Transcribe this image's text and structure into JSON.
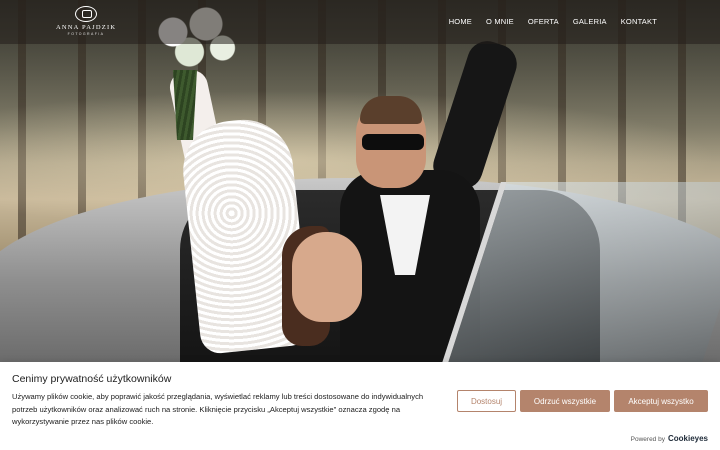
{
  "header": {
    "logo": {
      "name": "ANNA PAJDZIK",
      "subtitle": "FOTOGRAFIA"
    },
    "nav": [
      {
        "label": "HOME"
      },
      {
        "label": "O MNIE"
      },
      {
        "label": "OFERTA"
      },
      {
        "label": "GALERIA"
      },
      {
        "label": "KONTAKT"
      }
    ]
  },
  "hero": {
    "image": "wedding-photo-bride-groom-convertible-car"
  },
  "cookie_banner": {
    "title": "Cenimy prywatność użytkowników",
    "text": "Używamy plików cookie, aby poprawić jakość przeglądania, wyświetlać reklamy lub treści dostosowane do indywidualnych potrzeb użytkowników oraz analizować ruch na stronie. Kliknięcie przycisku „Akceptuj wszystkie\" oznacza zgodę na wykorzystywanie przez nas plików cookie.",
    "buttons": {
      "customize": "Dostosuj",
      "reject": "Odrzuć wszystkie",
      "accept": "Akceptuj wszystko"
    },
    "powered_by": "Powered by",
    "brand": "Cookieyes"
  },
  "colors": {
    "accent": "#b4846c",
    "header_overlay": "rgba(35,30,25,.55)",
    "text": "#212121"
  }
}
